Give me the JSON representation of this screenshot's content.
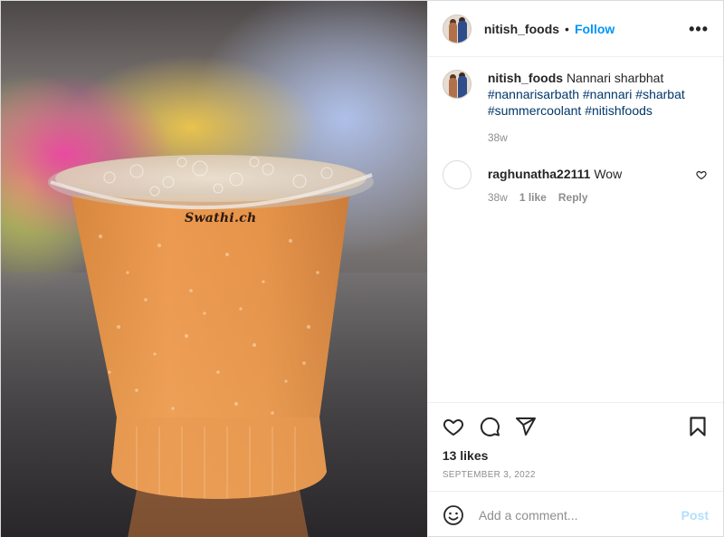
{
  "post": {
    "author": {
      "username": "nitish_foods",
      "follow_label": "Follow",
      "dot": "•"
    },
    "image": {
      "watermark": "Swathi.ch"
    },
    "caption": {
      "username": "nitish_foods",
      "text": "Nannari sharbhat",
      "hashtags": [
        "#nannarisarbath",
        "#nannari",
        "#sharbat",
        "#summercoolant",
        "#nitishfoods"
      ],
      "age": "38w"
    },
    "comments": [
      {
        "username": "raghunatha22111",
        "text": "Wow",
        "age": "38w",
        "likes_label": "1 like",
        "reply_label": "Reply"
      }
    ],
    "likes": "13 likes",
    "date": "SEPTEMBER 3, 2022",
    "add_comment": {
      "placeholder": "Add a comment...",
      "post_label": "Post"
    }
  },
  "icons": {
    "more": "more-options-icon",
    "like": "heart-icon",
    "comment": "comment-icon",
    "share": "share-icon",
    "save": "bookmark-icon",
    "emoji": "emoji-icon",
    "comment_like": "heart-icon"
  },
  "colors": {
    "accent": "#0095f6",
    "link": "#00376b",
    "muted": "#8e8e8e",
    "post_disabled": "#b2dffc"
  }
}
